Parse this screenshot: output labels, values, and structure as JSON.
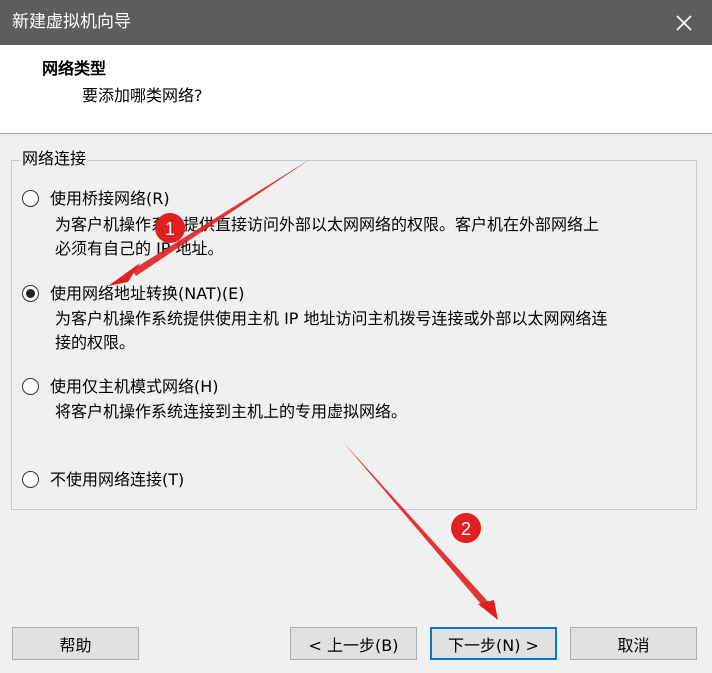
{
  "window": {
    "title": "新建虚拟机向导",
    "close_icon": "close-icon"
  },
  "header": {
    "title": "网络类型",
    "subtitle": "要添加哪类网络?"
  },
  "group": {
    "legend": "网络连接"
  },
  "options": [
    {
      "label": "使用桥接网络(R)",
      "desc_lines": [
        "为客户机操作系统提供直接访问外部以太网网络的权限。客户机在外部网络上",
        "必须有自己的 IP 地址。"
      ],
      "selected": false
    },
    {
      "label": "使用网络地址转换(NAT)(E)",
      "desc_lines": [
        "为客户机操作系统提供使用主机 IP 地址访问主机拨号连接或外部以太网网络连",
        "接的权限。"
      ],
      "selected": true
    },
    {
      "label": "使用仅主机模式网络(H)",
      "desc_lines": [
        "将客户机操作系统连接到主机上的专用虚拟网络。"
      ],
      "selected": false
    },
    {
      "label": "不使用网络连接(T)",
      "desc_lines": [],
      "selected": false
    }
  ],
  "buttons": {
    "help": "帮助",
    "back": "< 上一步(B)",
    "next": "下一步(N) >",
    "cancel": "取消"
  },
  "annotations": {
    "marker1": "1",
    "marker2": "2"
  },
  "colors": {
    "titlebar": "#5d5d5d",
    "annotation": "#e02020",
    "focus": "#0078d7"
  }
}
